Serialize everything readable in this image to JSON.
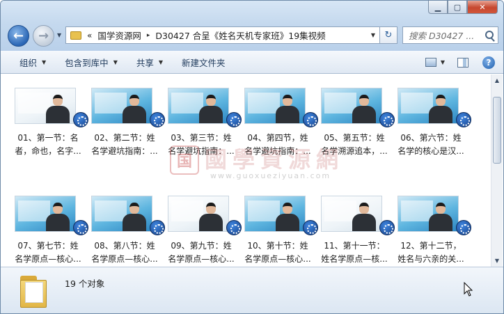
{
  "window": {
    "minimize": "▁",
    "maximize": "▢",
    "close": "✕"
  },
  "address": {
    "chevrons": "«",
    "crumbs": [
      "国学资源网",
      "D30427 合呈《姓名天机专家班》19集视频"
    ],
    "separator": "▸"
  },
  "search": {
    "placeholder": "搜索 D30427 ..."
  },
  "toolbar": {
    "organize": "组织",
    "include_library": "包含到库中",
    "share": "共享",
    "new_folder": "新建文件夹",
    "help": "?"
  },
  "files": [
    {
      "line1": "01、第一节：名",
      "line2": "者，命也，名字..."
    },
    {
      "line1": "02、第二节：姓",
      "line2": "名学避坑指南：..."
    },
    {
      "line1": "03、第三节：姓",
      "line2": "名学避坑指南：..."
    },
    {
      "line1": "04、第四节，姓",
      "line2": "名学避坑指南：..."
    },
    {
      "line1": "05、第五节：姓",
      "line2": "名学溯源追本，..."
    },
    {
      "line1": "06、第六节：姓",
      "line2": "名学的核心是汉..."
    },
    {
      "line1": "07、第七节：姓",
      "line2": "名学原点—核心..."
    },
    {
      "line1": "08、第八节：姓",
      "line2": "名学原点—核心..."
    },
    {
      "line1": "09、第九节：姓",
      "line2": "名学原点—核心..."
    },
    {
      "line1": "10、第十节：姓",
      "line2": "名学原点—核心..."
    },
    {
      "line1": "11、第十一节：",
      "line2": "姓名学原点—核..."
    },
    {
      "line1": "12、第十二节，",
      "line2": "姓名与六亲的关..."
    }
  ],
  "watermark": {
    "seal": "国",
    "title": "國學資源網",
    "url": "www.guoxueziyuan.com"
  },
  "details": {
    "count": "19 个对象"
  }
}
